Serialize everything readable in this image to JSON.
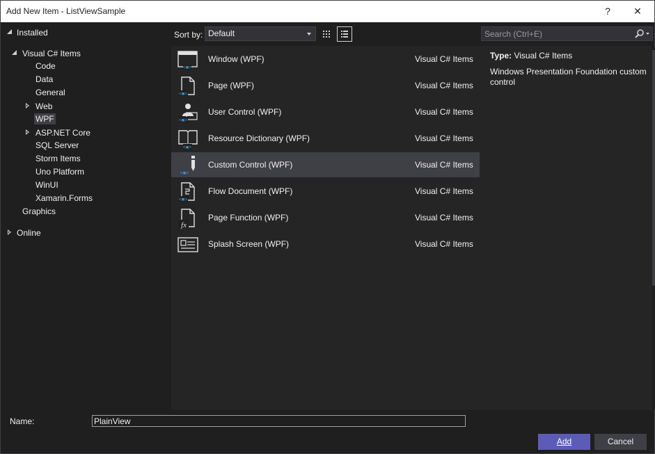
{
  "window": {
    "title": "Add New Item - ListViewSample",
    "help_label": "?",
    "close_label": "✕"
  },
  "tree": {
    "installed": "Installed",
    "visual_csharp": "Visual C# Items",
    "children": [
      "Code",
      "Data",
      "General",
      "Web",
      "WPF",
      "ASP.NET Core",
      "SQL Server",
      "Storm Items",
      "Uno Platform",
      "WinUI",
      "Xamarin.Forms"
    ],
    "graphics": "Graphics",
    "online": "Online",
    "selected": "WPF"
  },
  "sort": {
    "label": "Sort by:",
    "value": "Default"
  },
  "search": {
    "placeholder": "Search (Ctrl+E)"
  },
  "templates": [
    {
      "name": "Window (WPF)",
      "category": "Visual C# Items",
      "icon": "window-icon"
    },
    {
      "name": "Page (WPF)",
      "category": "Visual C# Items",
      "icon": "page-icon"
    },
    {
      "name": "User Control (WPF)",
      "category": "Visual C# Items",
      "icon": "user-control-icon"
    },
    {
      "name": "Resource Dictionary (WPF)",
      "category": "Visual C# Items",
      "icon": "resource-dictionary-icon"
    },
    {
      "name": "Custom Control (WPF)",
      "category": "Visual C# Items",
      "icon": "custom-control-icon"
    },
    {
      "name": "Flow Document (WPF)",
      "category": "Visual C# Items",
      "icon": "flow-document-icon"
    },
    {
      "name": "Page Function (WPF)",
      "category": "Visual C# Items",
      "icon": "page-function-icon"
    },
    {
      "name": "Splash Screen (WPF)",
      "category": "Visual C# Items",
      "icon": "splash-screen-icon"
    }
  ],
  "selected_template": "Custom Control (WPF)",
  "details": {
    "type_label": "Type:",
    "type_value": "Visual C# Items",
    "description": "Windows Presentation Foundation custom control"
  },
  "form": {
    "name_label": "Name:",
    "name_value": "PlainView"
  },
  "buttons": {
    "add": "Add",
    "cancel": "Cancel"
  },
  "colors": {
    "accent_button": "#5c5cb8",
    "selection": "#3f3f46",
    "xaml_blue": "#3a96dd"
  }
}
